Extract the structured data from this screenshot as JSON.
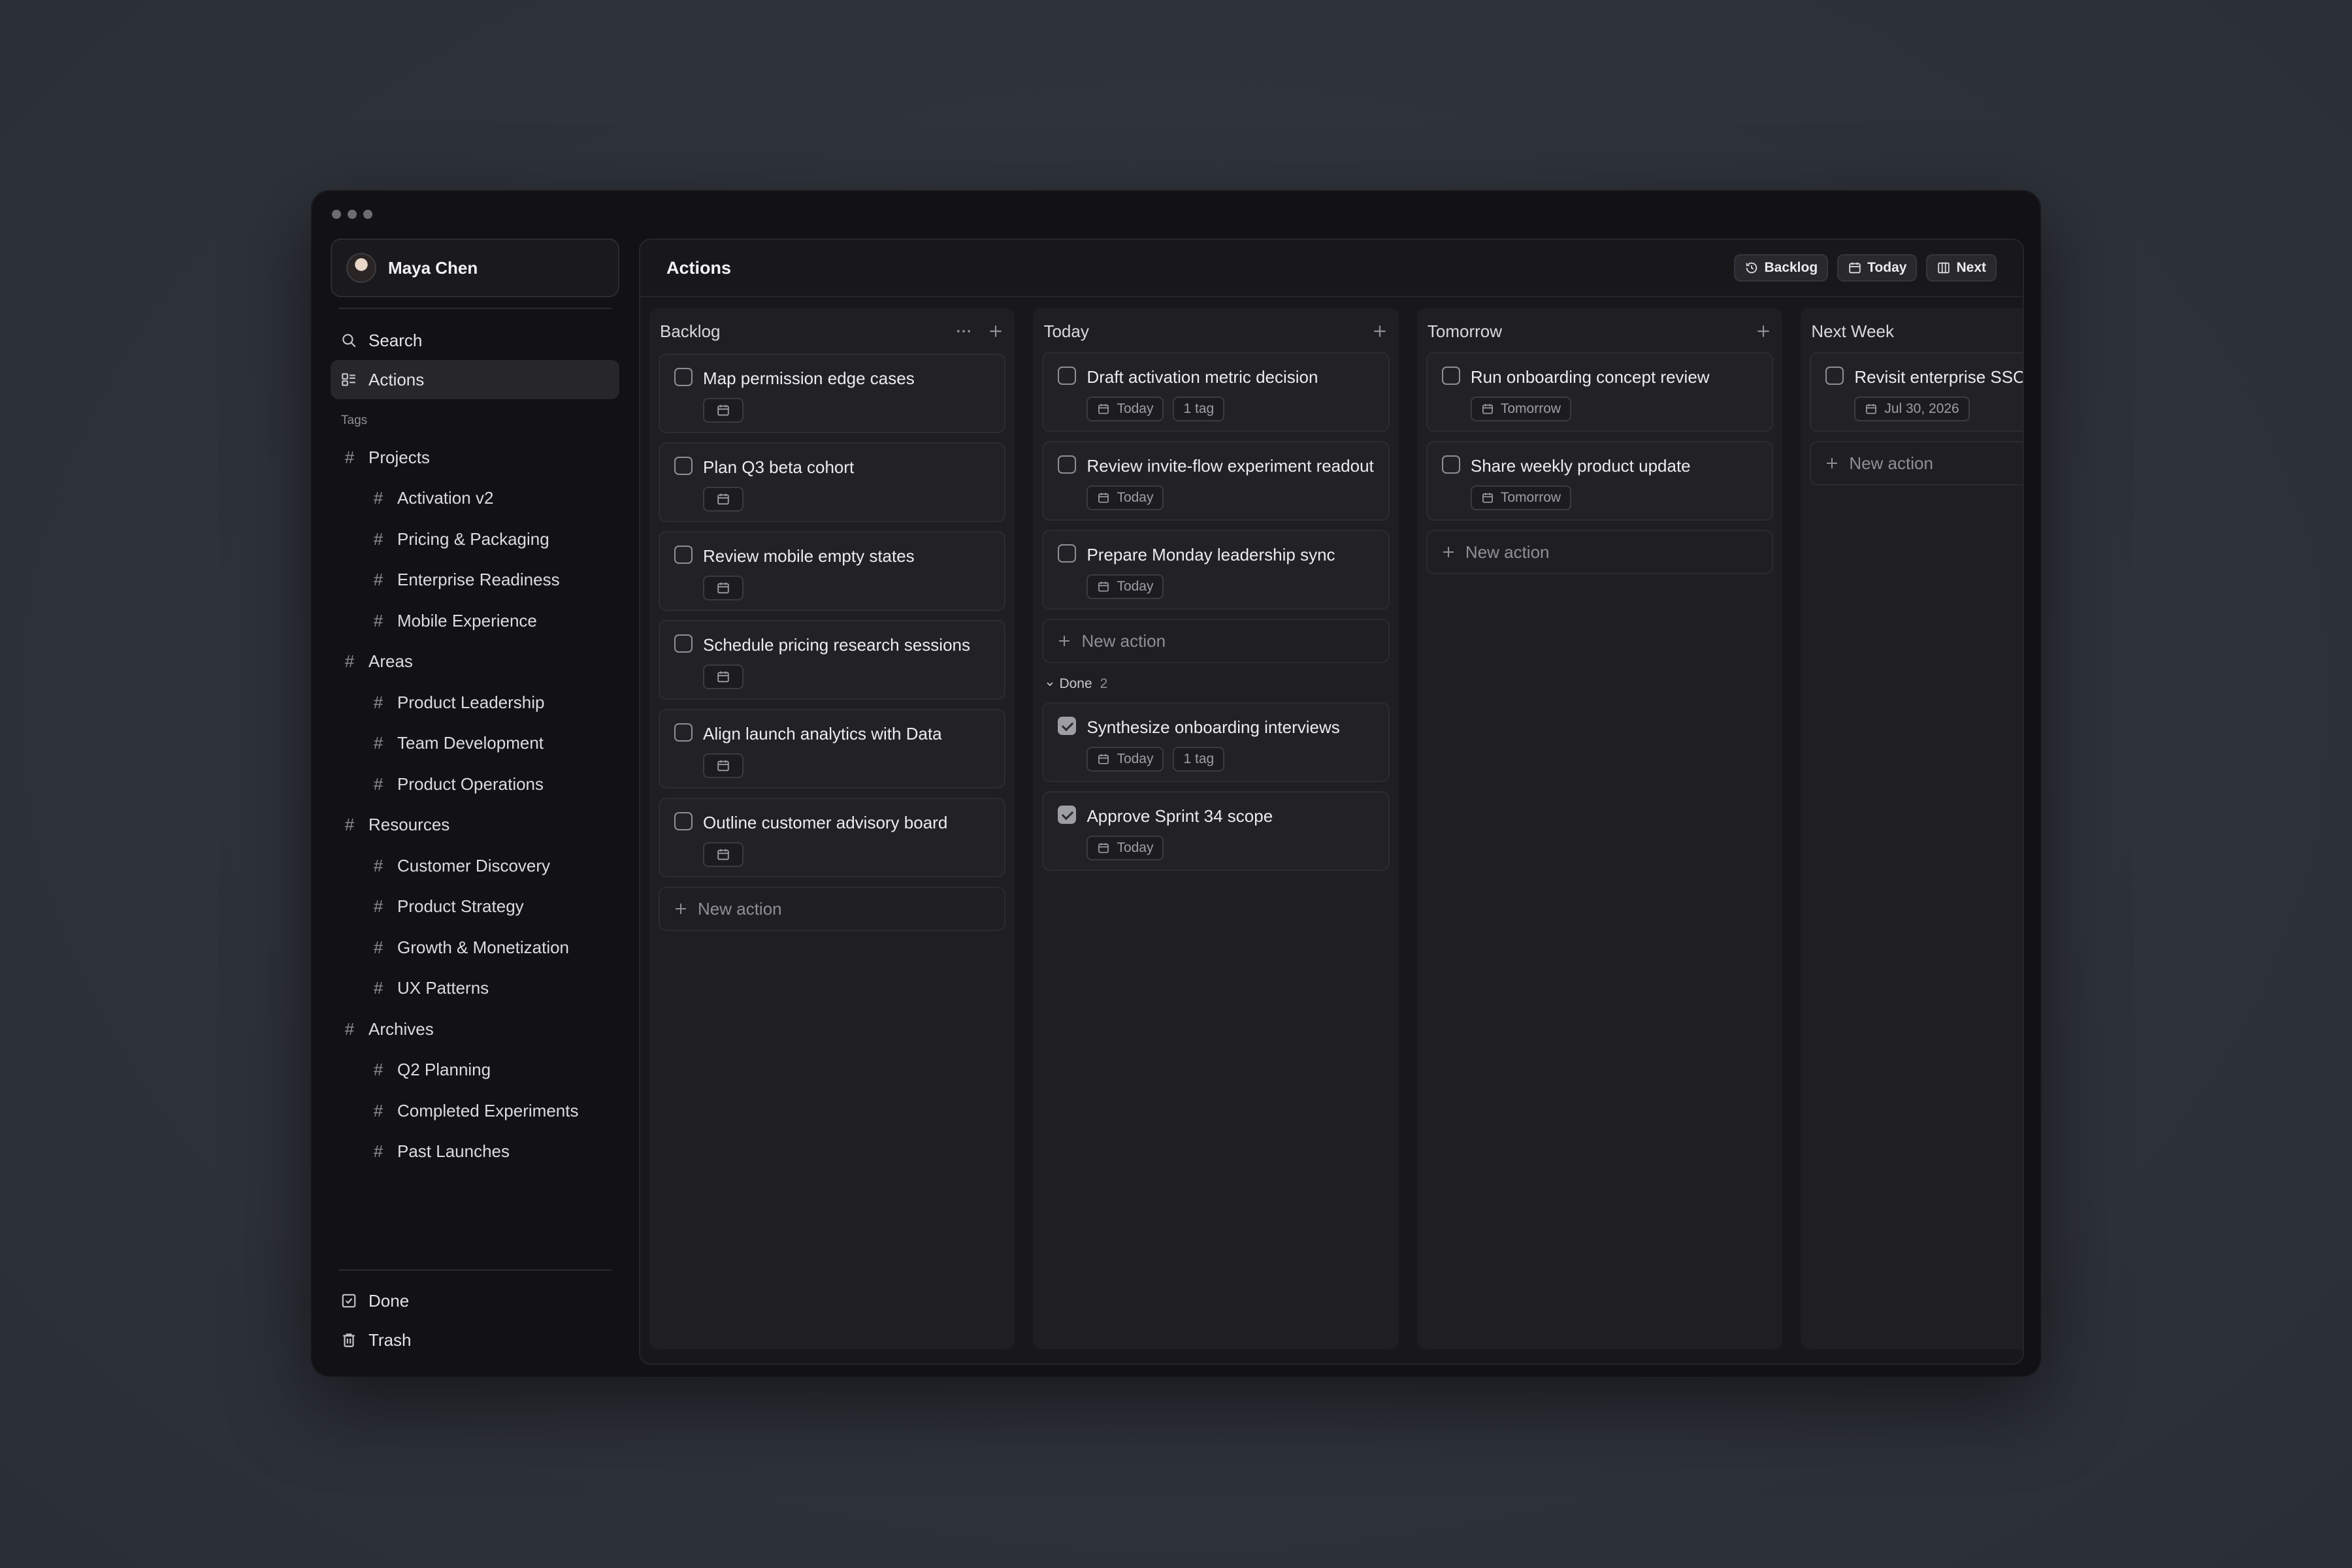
{
  "profile": {
    "name": "Maya Chen"
  },
  "nav": {
    "search": "Search",
    "actions": "Actions"
  },
  "tags_label": "Tags",
  "tag_groups": [
    {
      "label": "Projects",
      "children": [
        "Activation v2",
        "Pricing & Packaging",
        "Enterprise Readiness",
        "Mobile Experience"
      ]
    },
    {
      "label": "Areas",
      "children": [
        "Product Leadership",
        "Team Development",
        "Product Operations"
      ]
    },
    {
      "label": "Resources",
      "children": [
        "Customer Discovery",
        "Product Strategy",
        "Growth & Monetization",
        "UX Patterns"
      ]
    },
    {
      "label": "Archives",
      "children": [
        "Q2 Planning",
        "Completed Experiments",
        "Past Launches"
      ]
    }
  ],
  "bottom_nav": {
    "done": "Done",
    "trash": "Trash"
  },
  "main": {
    "title": "Actions",
    "views": {
      "backlog": "Backlog",
      "today": "Today",
      "next": "Next"
    }
  },
  "columns": {
    "backlog": {
      "title": "Backlog",
      "cards": [
        "Map permission edge cases",
        "Plan Q3 beta cohort",
        "Review mobile empty states",
        "Schedule pricing research sessions",
        "Align launch analytics with Data",
        "Outline customer advisory board"
      ],
      "new_action": "New action"
    },
    "today": {
      "title": "Today",
      "cards": [
        {
          "title": "Draft activation metric decision",
          "date": "Today",
          "tag": "1 tag"
        },
        {
          "title": "Review invite-flow experiment readout",
          "date": "Today"
        },
        {
          "title": "Prepare Monday leadership sync",
          "date": "Today"
        }
      ],
      "new_action": "New action",
      "done_label": "Done",
      "done_count": "2",
      "done_cards": [
        {
          "title": "Synthesize onboarding interviews",
          "date": "Today",
          "tag": "1 tag"
        },
        {
          "title": "Approve Sprint 34 scope",
          "date": "Today"
        }
      ]
    },
    "tomorrow": {
      "title": "Tomorrow",
      "cards": [
        {
          "title": "Run onboarding concept review",
          "date": "Tomorrow"
        },
        {
          "title": "Share weekly product update",
          "date": "Tomorrow"
        }
      ],
      "new_action": "New action"
    },
    "next_week": {
      "title": "Next Week",
      "cards": [
        {
          "title": "Revisit enterprise SSO",
          "date": "Jul 30, 2026"
        }
      ],
      "new_action": "New action"
    }
  }
}
